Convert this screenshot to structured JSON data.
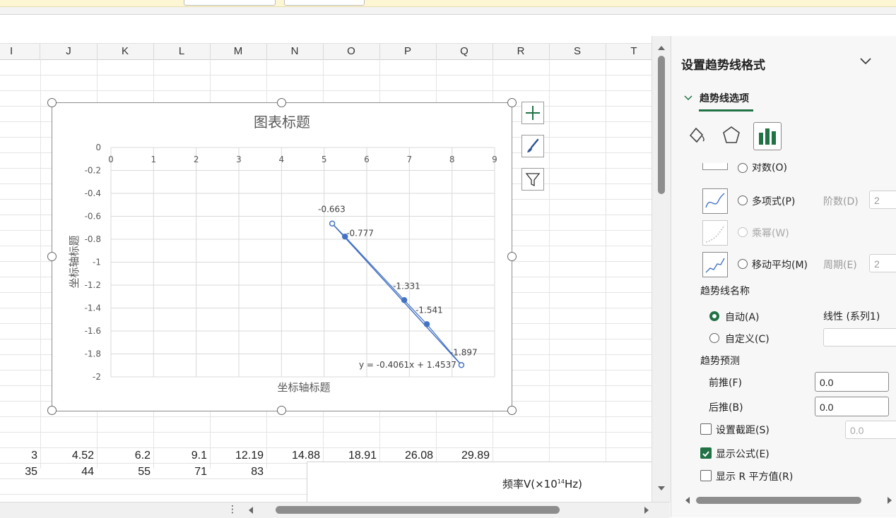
{
  "sheet": {
    "columns": [
      "I",
      "J",
      "K",
      "L",
      "M",
      "N",
      "O",
      "P",
      "Q",
      "R",
      "S",
      "T"
    ],
    "row_a": [
      "3",
      "4.52",
      "6.2",
      "9.1",
      "12.19",
      "14.88",
      "18.91",
      "26.08",
      "29.89"
    ],
    "row_b": [
      "35",
      "44",
      "55",
      "71",
      "83"
    ],
    "freq_label": "频率V(×10",
    "freq_sup": "14",
    "freq_unit": "Hz)"
  },
  "chart_data": {
    "type": "scatter",
    "title": "图表标题",
    "xlabel": "坐标轴标题",
    "ylabel": "坐标轴标题",
    "xlim": [
      0,
      9
    ],
    "ylim": [
      -2,
      0
    ],
    "x_ticks": [
      "0",
      "1",
      "2",
      "3",
      "4",
      "5",
      "6",
      "7",
      "8",
      "9"
    ],
    "y_ticks": [
      "0",
      "-0.2",
      "-0.4",
      "-0.6",
      "-0.8",
      "-1",
      "-1.2",
      "-1.4",
      "-1.6",
      "-1.8",
      "-2"
    ],
    "grid": true,
    "series": [
      {
        "x": [
          5.19,
          5.49,
          6.88,
          7.41,
          8.22
        ],
        "y": [
          -0.663,
          -0.777,
          -1.331,
          -1.541,
          -1.897
        ],
        "labels": [
          "-0.663",
          "-0.777",
          "-1.331",
          "-1.541",
          "-1.897"
        ],
        "color": "#4472c4"
      }
    ],
    "trendline": {
      "type": "linear",
      "slope": -0.4061,
      "intercept": 1.4537,
      "equation": "y = -0.4061x + 1.4537"
    }
  },
  "pane": {
    "title": "设置趋势线格式",
    "tab": "趋势线选项",
    "options": {
      "log": "对数(O)",
      "poly": "多项式(P)",
      "order_label": "阶数(D)",
      "order_value": "2",
      "power": "乘幂(W)",
      "moving": "移动平均(M)",
      "period_label": "周期(E)",
      "period_value": "2"
    },
    "name_section": "趋势线名称",
    "auto": "自动(A)",
    "auto_value": "线性 (系列1)",
    "custom": "自定义(C)",
    "forecast_section": "趋势预测",
    "forward": "前推(F)",
    "forward_value": "0.0",
    "backward": "后推(B)",
    "backward_value": "0.0",
    "intercept": "设置截距(S)",
    "intercept_value": "0.0",
    "show_equation": "显示公式(E)",
    "show_r2": "显示 R 平方值(R)"
  },
  "colors": {
    "accent": "#217346",
    "series": "#4472c4"
  }
}
